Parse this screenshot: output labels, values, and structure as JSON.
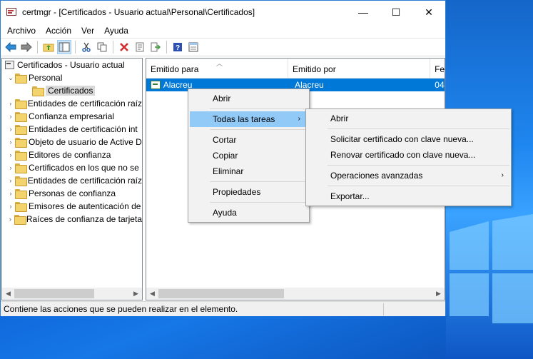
{
  "window": {
    "title": "certmgr - [Certificados - Usuario actual\\Personal\\Certificados]",
    "min_icon": "—",
    "max_icon": "☐",
    "close_icon": "✕"
  },
  "menubar": [
    "Archivo",
    "Acción",
    "Ver",
    "Ayuda"
  ],
  "toolbar": {
    "back_icon": "back-arrow",
    "forward_icon": "forward-arrow",
    "buttons": [
      "up-folder",
      "show-hide-tree",
      "cut",
      "copy",
      "delete",
      "properties",
      "export",
      "help",
      "view"
    ]
  },
  "tree": {
    "root": "Certificados - Usuario actual",
    "items": [
      {
        "label": "Personal",
        "expanded": true
      },
      {
        "label": "Certificados",
        "selected": true
      },
      {
        "label": "Entidades de certificación raíz"
      },
      {
        "label": "Confianza empresarial"
      },
      {
        "label": "Entidades de certificación int"
      },
      {
        "label": "Objeto de usuario de Active D"
      },
      {
        "label": "Editores de confianza"
      },
      {
        "label": "Certificados en los que no se"
      },
      {
        "label": "Entidades de certificación raíz"
      },
      {
        "label": "Personas de confianza"
      },
      {
        "label": "Emisores de autenticación de"
      },
      {
        "label": "Raíces de confianza de tarjeta"
      }
    ]
  },
  "list": {
    "columns": [
      "Emitido para",
      "Emitido por",
      "Fe"
    ],
    "rows": [
      {
        "issued_to": "Alacreu",
        "issued_by": "Alacreu",
        "date": "04"
      }
    ]
  },
  "status": "Contiene las acciones que se pueden realizar en el elemento.",
  "context_menu": {
    "items": [
      "Abrir",
      "Todas las tareas",
      "Cortar",
      "Copiar",
      "Eliminar",
      "Propiedades",
      "Ayuda"
    ],
    "submenu_arrow": "›"
  },
  "submenu": {
    "items": [
      "Abrir",
      "Solicitar certificado con clave nueva...",
      "Renovar certificado con clave nueva...",
      "Operaciones avanzadas",
      "Exportar..."
    ]
  }
}
